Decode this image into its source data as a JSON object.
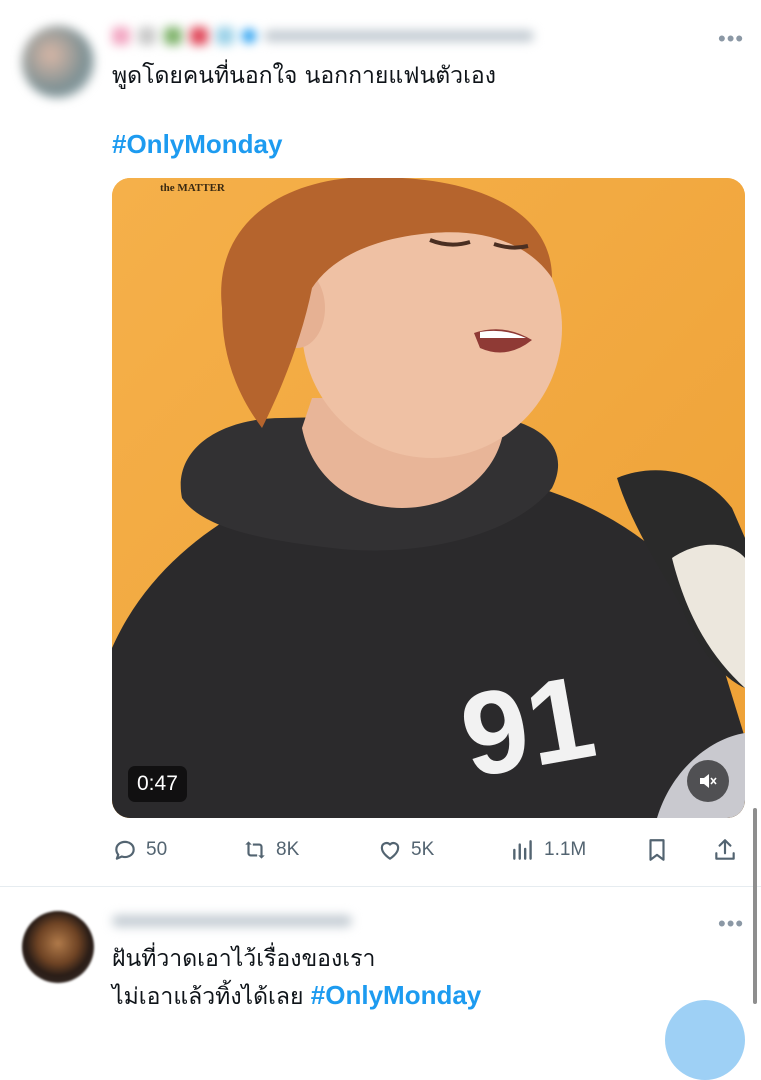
{
  "tweet1": {
    "text_line1": "พูดโดยคนที่นอกใจ นอกกายแฟนตัวเอง",
    "hashtag": "#OnlyMonday",
    "more": "•••",
    "media": {
      "duration": "0:47",
      "brand": "the MATTER",
      "shirt_number": "91"
    },
    "actions": {
      "replies": "50",
      "reposts": "8K",
      "likes": "5K",
      "views": "1.1M"
    }
  },
  "tweet2": {
    "text_line1": "ฝันที่วาดเอาไว้เรื่องของเรา",
    "text_line2": "ไม่เอาแล้วทิ้งได้เลย",
    "hashtag": "#OnlyMonday",
    "more": "•••"
  },
  "colors": {
    "accent": "#1d9bf0",
    "icon_gray": "#536471",
    "media_bg": "#f3a93d"
  }
}
